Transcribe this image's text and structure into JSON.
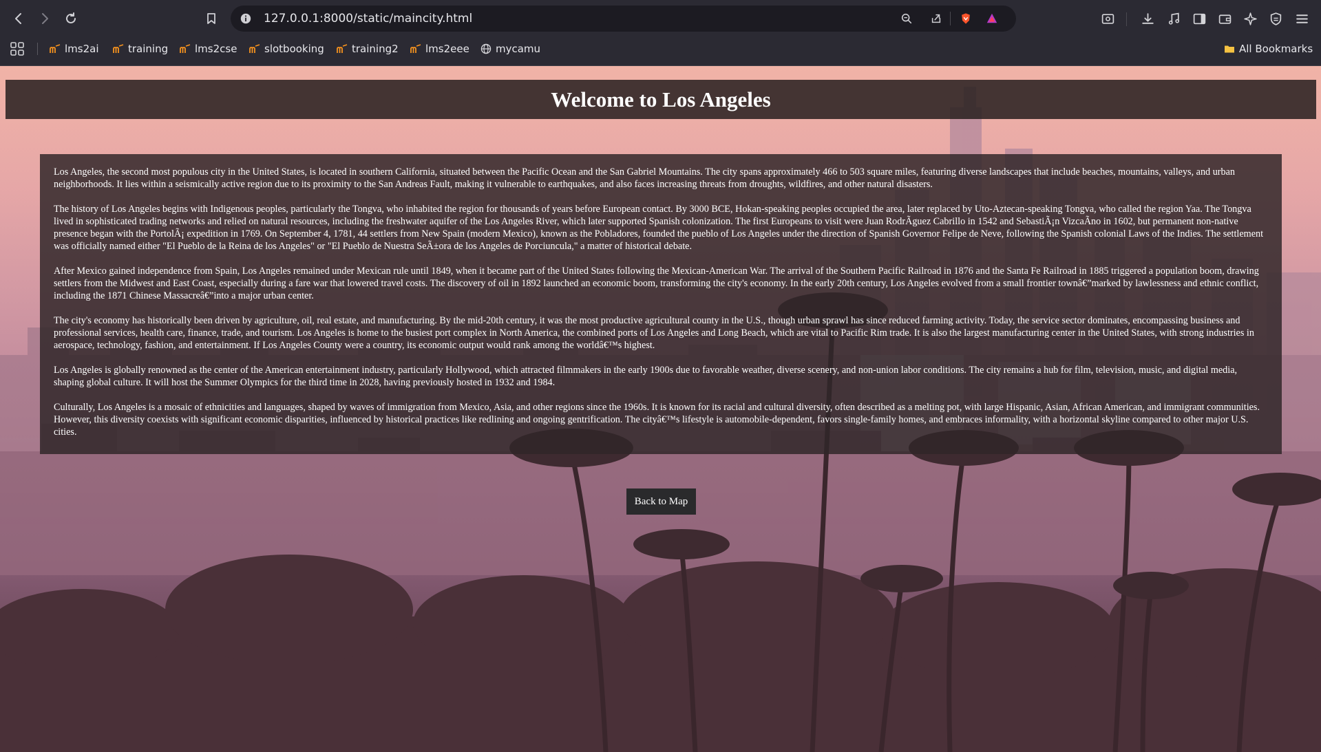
{
  "browser": {
    "url": "127.0.0.1:8000/static/maincity.html",
    "bookmarks": [
      {
        "label": "lms2ai",
        "icon": "moodle-icon"
      },
      {
        "label": "training",
        "icon": "moodle-icon"
      },
      {
        "label": "lms2cse",
        "icon": "moodle-icon"
      },
      {
        "label": "slotbooking",
        "icon": "moodle-icon"
      },
      {
        "label": "training2",
        "icon": "moodle-icon"
      },
      {
        "label": "lms2eee",
        "icon": "moodle-icon"
      },
      {
        "label": "mycamu",
        "icon": "globe-icon"
      }
    ],
    "all_bookmarks_label": "All Bookmarks"
  },
  "page": {
    "title": "Welcome to Los Angeles",
    "paragraphs": [
      "Los Angeles, the second most populous city in the United States, is located in southern California, situated between the Pacific Ocean and the San Gabriel Mountains. The city spans approximately 466 to 503 square miles, featuring diverse landscapes that include beaches, mountains, valleys, and urban neighborhoods. It lies within a seismically active region due to its proximity to the San Andreas Fault, making it vulnerable to earthquakes, and also faces increasing threats from droughts, wildfires, and other natural disasters.",
      "The history of Los Angeles begins with Indigenous peoples, particularly the Tongva, who inhabited the region for thousands of years before European contact. By 3000 BCE, Hokan-speaking peoples occupied the area, later replaced by Uto-Aztecan-speaking Tongva, who called the region Yaa. The Tongva lived in sophisticated trading networks and relied on natural resources, including the freshwater aquifer of the Los Angeles River, which later supported Spanish colonization. The first Europeans to visit were Juan RodrÃguez Cabrillo in 1542 and SebastiÃ¡n VizcaÃno in 1602, but permanent non-native presence began with the PortolÃ¡ expedition in 1769. On September 4, 1781, 44 settlers from New Spain (modern Mexico), known as the Pobladores, founded the pueblo of Los Angeles under the direction of Spanish Governor Felipe de Neve, following the Spanish colonial Laws of the Indies. The settlement was officially named either \"El Pueblo de la Reina de los Angeles\" or \"El Pueblo de Nuestra SeÃ±ora de los Angeles de Porciuncula,\" a matter of historical debate.",
      "After Mexico gained independence from Spain, Los Angeles remained under Mexican rule until 1849, when it became part of the United States following the Mexican-American War. The arrival of the Southern Pacific Railroad in 1876 and the Santa Fe Railroad in 1885 triggered a population boom, drawing settlers from the Midwest and East Coast, especially during a fare war that lowered travel costs. The discovery of oil in 1892 launched an economic boom, transforming the city's economy. In the early 20th century, Los Angeles evolved from a small frontier townâ€”marked by lawlessness and ethnic conflict, including the 1871 Chinese Massacreâ€”into a major urban center.",
      "The city's economy has historically been driven by agriculture, oil, real estate, and manufacturing. By the mid-20th century, it was the most productive agricultural county in the U.S., though urban sprawl has since reduced farming activity. Today, the service sector dominates, encompassing business and professional services, health care, finance, trade, and tourism. Los Angeles is home to the busiest port complex in North America, the combined ports of Los Angeles and Long Beach, which are vital to Pacific Rim trade. It is also the largest manufacturing center in the United States, with strong industries in aerospace, technology, fashion, and entertainment. If Los Angeles County were a country, its economic output would rank among the worldâ€™s highest.",
      "Los Angeles is globally renowned as the center of the American entertainment industry, particularly Hollywood, which attracted filmmakers in the early 1900s due to favorable weather, diverse scenery, and non-union labor conditions. The city remains a hub for film, television, music, and digital media, shaping global culture. It will host the Summer Olympics for the third time in 2028, having previously hosted in 1932 and 1984.",
      "Culturally, Los Angeles is a mosaic of ethnicities and languages, shaped by waves of immigration from Mexico, Asia, and other regions since the 1960s. It is known for its racial and cultural diversity, often described as a melting pot, with large Hispanic, Asian, African American, and immigrant communities. However, this diversity coexists with significant economic disparities, influenced by historical practices like redlining and ongoing gentrification. The cityâ€™s lifestyle is automobile-dependent, favors single-family homes, and embraces informality, with a horizontal skyline compared to other major U.S. cities."
    ],
    "back_button_label": "Back to Map"
  },
  "colors": {
    "header_bg": "#282020",
    "content_bg": "#302628",
    "button_bg": "#2a2a2c",
    "sky_top": "#f1b3a7",
    "sky_bottom": "#3f2c34"
  }
}
